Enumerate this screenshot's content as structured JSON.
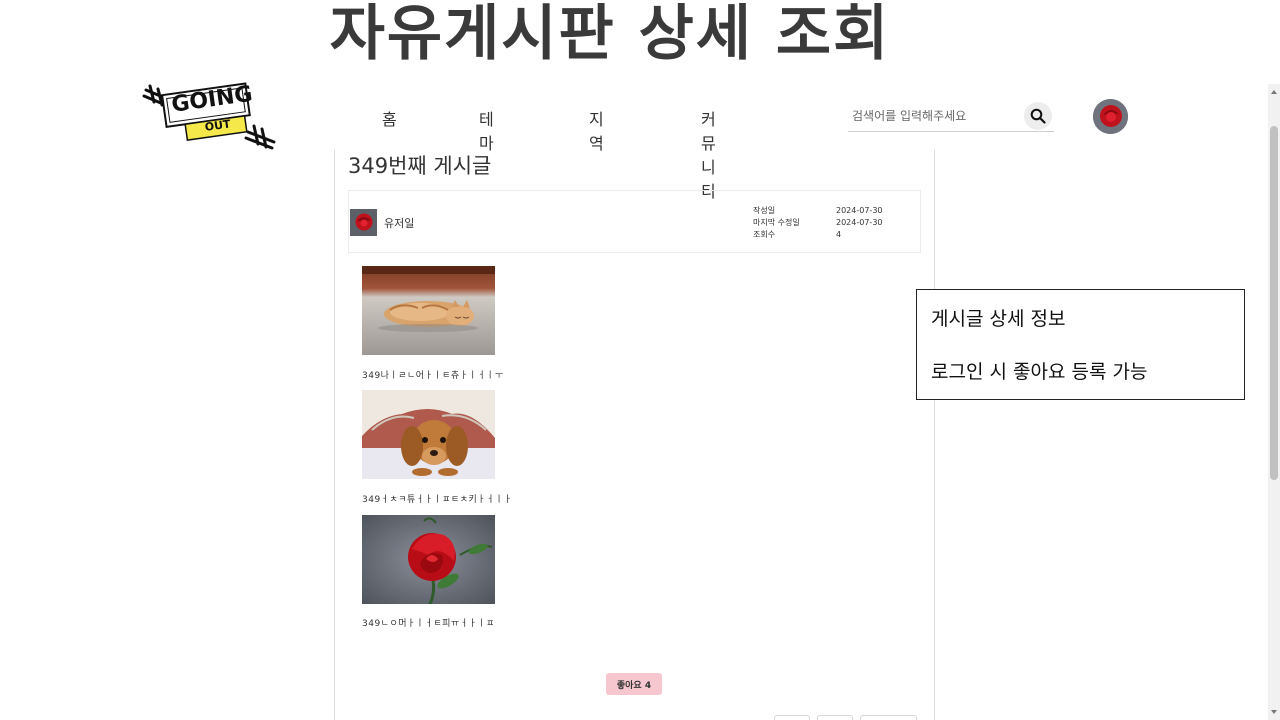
{
  "slide_title": "자유게시판 상세 조회",
  "logo": {
    "line1": "GOING",
    "line2": "OUT"
  },
  "nav": {
    "items": [
      "홈",
      "테마",
      "지역",
      "커뮤니티"
    ]
  },
  "search": {
    "placeholder": "검색어를 입력해주세요",
    "icon": "search-icon"
  },
  "user": {
    "avatar": "rose-avatar"
  },
  "post": {
    "title": "349번째 게시글",
    "author": "유저일",
    "meta_labels": [
      "작성일",
      "마지막 수정일",
      "조회수"
    ],
    "meta_values": [
      "2024-07-30",
      "2024-07-30",
      "4"
    ],
    "images": [
      {
        "subject": "sleeping-kitten-photo",
        "caption": "349나ㅣㄹㄴ어ㅏㅣㅌ츄ㅏㅣㅓㅣㅜ"
      },
      {
        "subject": "puppy-under-blanket-photo",
        "caption": "349ㅓㅊㅋ튜ㅓㅏㅣㅍㅌㅊ키ㅏㅓㅣㅏ"
      },
      {
        "subject": "red-rose-photo",
        "caption": "349ㄴㅇ머ㅏㅣㅓㅌ피ㅠㅓㅏㅣㅍ"
      }
    ],
    "like_label": "좋아요 4"
  },
  "note": {
    "line1": "게시글 상세 정보",
    "line2": "로그인 시 좋아요 등록 가능"
  },
  "colors": {
    "like_bg": "#f6c7ce",
    "logo_yellow": "#f5e84a",
    "title": "#3a3a3a"
  }
}
